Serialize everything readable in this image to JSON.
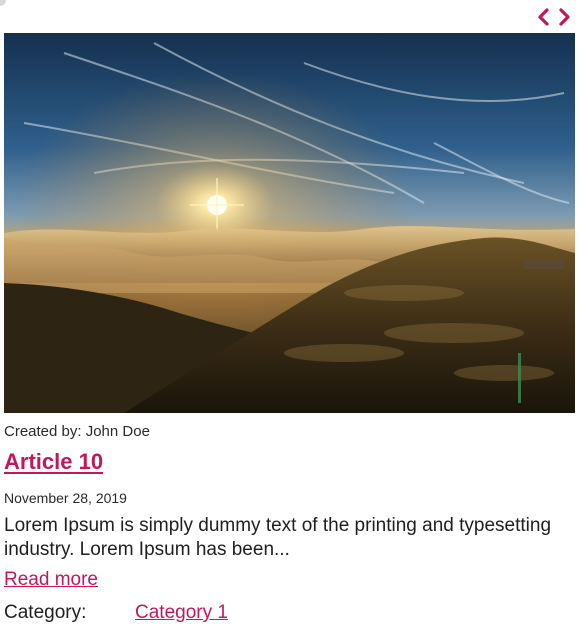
{
  "navigation": {
    "prev_icon": "chevron-left-icon",
    "next_icon": "chevron-right-icon",
    "accent_color": "#c2185b"
  },
  "article": {
    "image_alt_icon": "landscape-photo",
    "author_line": "Created by: John Doe",
    "title": "Article 10",
    "date": "November 28, 2019",
    "excerpt": "Lorem Ipsum is simply dummy text of the printing and typesetting industry. Lorem Ipsum has been...",
    "read_more_label": "Read more",
    "category_label": "Category:",
    "category_value": "Category 1"
  },
  "colors": {
    "link": "#c2185b",
    "text": "#1f1f1f"
  }
}
